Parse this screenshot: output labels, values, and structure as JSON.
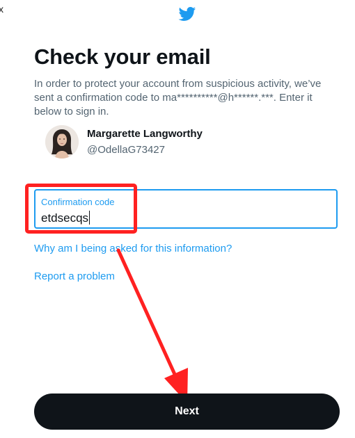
{
  "window": {
    "close_glyph": "x"
  },
  "header": {
    "logo_icon": "twitter-bird-icon",
    "brand_color": "#1d9bf0"
  },
  "main": {
    "title": "Check your email",
    "description": "In order to protect your account from suspicious activity, we’ve sent a confirmation code to ma**********@h******.***. Enter it below to sign in."
  },
  "user": {
    "name": "Margarette Langworthy",
    "handle": "@OdellaG73427"
  },
  "code_field": {
    "label": "Confirmation code",
    "value": "etdsecqs"
  },
  "links": {
    "why": "Why am I being asked for this information?",
    "report": "Report a problem"
  },
  "next_button": {
    "label": "Next"
  },
  "annotations": {
    "highlight_color": "#ff2121",
    "arrow_color": "#ff2121"
  }
}
